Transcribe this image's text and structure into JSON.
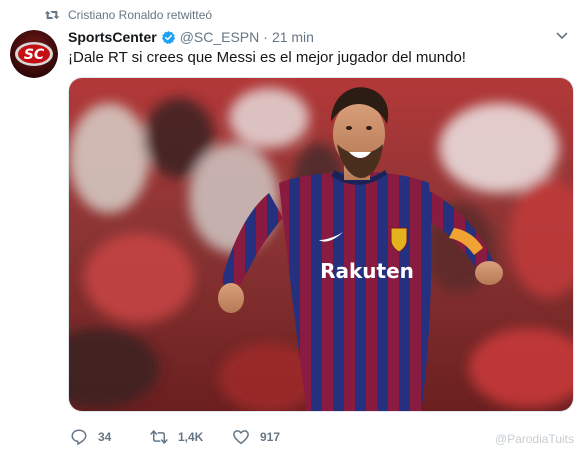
{
  "retweet_context": "Cristiano Ronaldo retwitteó",
  "author": {
    "name": "SportsCenter",
    "handle": "@SC_ESPN",
    "separator": "·",
    "time": "21 min",
    "avatar_text": "SC"
  },
  "tweet": {
    "text": "¡Dale RT si crees que Messi es el mejor jugador del mundo!"
  },
  "media": {
    "shirt_sponsor": "Rakuten"
  },
  "actions": {
    "replies": "34",
    "retweets": "1,4K",
    "likes": "917"
  },
  "watermark": "@ParodiaTuits",
  "colors": {
    "secondary_text": "#657786",
    "verified": "#1da1f2",
    "barca_blue": "#1d2c8f",
    "barca_red": "#a50044"
  }
}
